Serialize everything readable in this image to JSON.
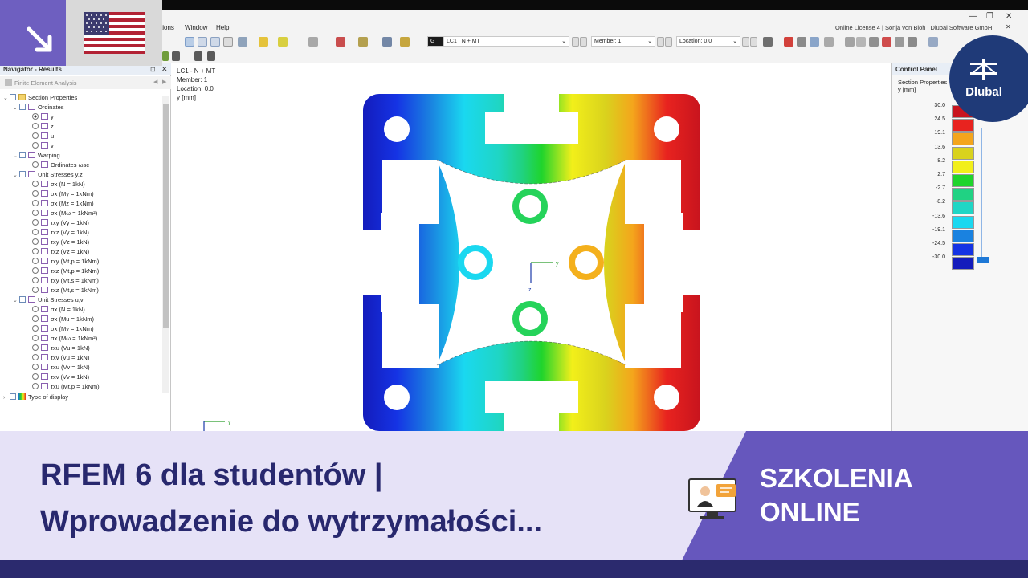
{
  "menu": {
    "items": [
      "tions",
      "Window",
      "Help"
    ],
    "license": "Online License 4 | Sonja von Bloh | Dlubal Software GmbH"
  },
  "toolbar": {
    "loadcase_code": "G",
    "loadcase_id": "LC1",
    "loadcase_name": "N + MT",
    "member": "Member: 1",
    "location": "Location: 0.0"
  },
  "navigator": {
    "title": "Navigator - Results",
    "module": "Finite Element Analysis",
    "tree": [
      {
        "label": "Section Properties",
        "kind": "folder"
      },
      {
        "label": "Ordinates",
        "kind": "group"
      },
      {
        "label": "y",
        "kind": "radio-on"
      },
      {
        "label": "z",
        "kind": "radio"
      },
      {
        "label": "u",
        "kind": "radio"
      },
      {
        "label": "v",
        "kind": "radio"
      },
      {
        "label": "Warping",
        "kind": "group"
      },
      {
        "label": "Ordinates ωsc",
        "kind": "radio"
      },
      {
        "label": "Unit Stresses y,z",
        "kind": "group"
      },
      {
        "label": "σx (N = 1kN)",
        "kind": "radio"
      },
      {
        "label": "σx (My = 1kNm)",
        "kind": "radio"
      },
      {
        "label": "σx (Mz = 1kNm)",
        "kind": "radio"
      },
      {
        "label": "σx (Mω = 1kNm²)",
        "kind": "radio"
      },
      {
        "label": "τxy (Vy = 1kN)",
        "kind": "radio"
      },
      {
        "label": "τxz (Vy = 1kN)",
        "kind": "radio"
      },
      {
        "label": "τxy (Vz = 1kN)",
        "kind": "radio"
      },
      {
        "label": "τxz (Vz = 1kN)",
        "kind": "radio"
      },
      {
        "label": "τxy (Mt,p = 1kNm)",
        "kind": "radio"
      },
      {
        "label": "τxz (Mt,p = 1kNm)",
        "kind": "radio"
      },
      {
        "label": "τxy (Mt,s = 1kNm)",
        "kind": "radio"
      },
      {
        "label": "τxz (Mt,s = 1kNm)",
        "kind": "radio"
      },
      {
        "label": "Unit Stresses u,v",
        "kind": "group"
      },
      {
        "label": "σx (N = 1kN)",
        "kind": "radio"
      },
      {
        "label": "σx (Mu = 1kNm)",
        "kind": "radio"
      },
      {
        "label": "σx (Mv = 1kNm)",
        "kind": "radio"
      },
      {
        "label": "σx (Mω = 1kNm²)",
        "kind": "radio"
      },
      {
        "label": "τxu (Vu = 1kN)",
        "kind": "radio"
      },
      {
        "label": "τxv (Vu = 1kN)",
        "kind": "radio"
      },
      {
        "label": "τxu (Vv = 1kN)",
        "kind": "radio"
      },
      {
        "label": "τxv (Vv = 1kN)",
        "kind": "radio"
      },
      {
        "label": "τxu (Mt,p = 1kNm)",
        "kind": "radio"
      }
    ],
    "type_of_display": "Type of display"
  },
  "canvas": {
    "info_line1": "LC1 - N + MT",
    "info_line2": "Member: 1",
    "info_line3": "Location: 0.0",
    "info_line4": "y [mm]",
    "axis_y": "y",
    "axis_z": "z"
  },
  "control_panel": {
    "title": "Control Panel",
    "subtitle1": "Section Properties",
    "subtitle2": "y [mm]",
    "legend": [
      {
        "value": "30.0",
        "color": "#c8141e"
      },
      {
        "value": "24.5",
        "color": "#e8231f"
      },
      {
        "value": "19.1",
        "color": "#f4a51c"
      },
      {
        "value": "13.6",
        "color": "#d9d21d"
      },
      {
        "value": "8.2",
        "color": "#f2ef1a"
      },
      {
        "value": "2.7",
        "color": "#1fd42c"
      },
      {
        "value": "-2.7",
        "color": "#20d283"
      },
      {
        "value": "-8.2",
        "color": "#1fd6c5"
      },
      {
        "value": "-13.6",
        "color": "#1ad8f0"
      },
      {
        "value": "-19.1",
        "color": "#1a82e0"
      },
      {
        "value": "-24.5",
        "color": "#1533e4"
      },
      {
        "value": "-30.0",
        "color": "#141cbc"
      }
    ]
  },
  "logo": {
    "text": "Dlubal"
  },
  "banner": {
    "title_line1": "RFEM 6 dla studentów |",
    "title_line2": "Wprowadzenie do wytrzymałości...",
    "badge_line1": "SZKOLENIA",
    "badge_line2": "ONLINE"
  },
  "colors": {
    "banner_bg": "#e6e2f7",
    "banner_accent": "#6657bd",
    "banner_text": "#28286e",
    "footer": "#2b2a6e",
    "logo": "#1f3a78"
  }
}
